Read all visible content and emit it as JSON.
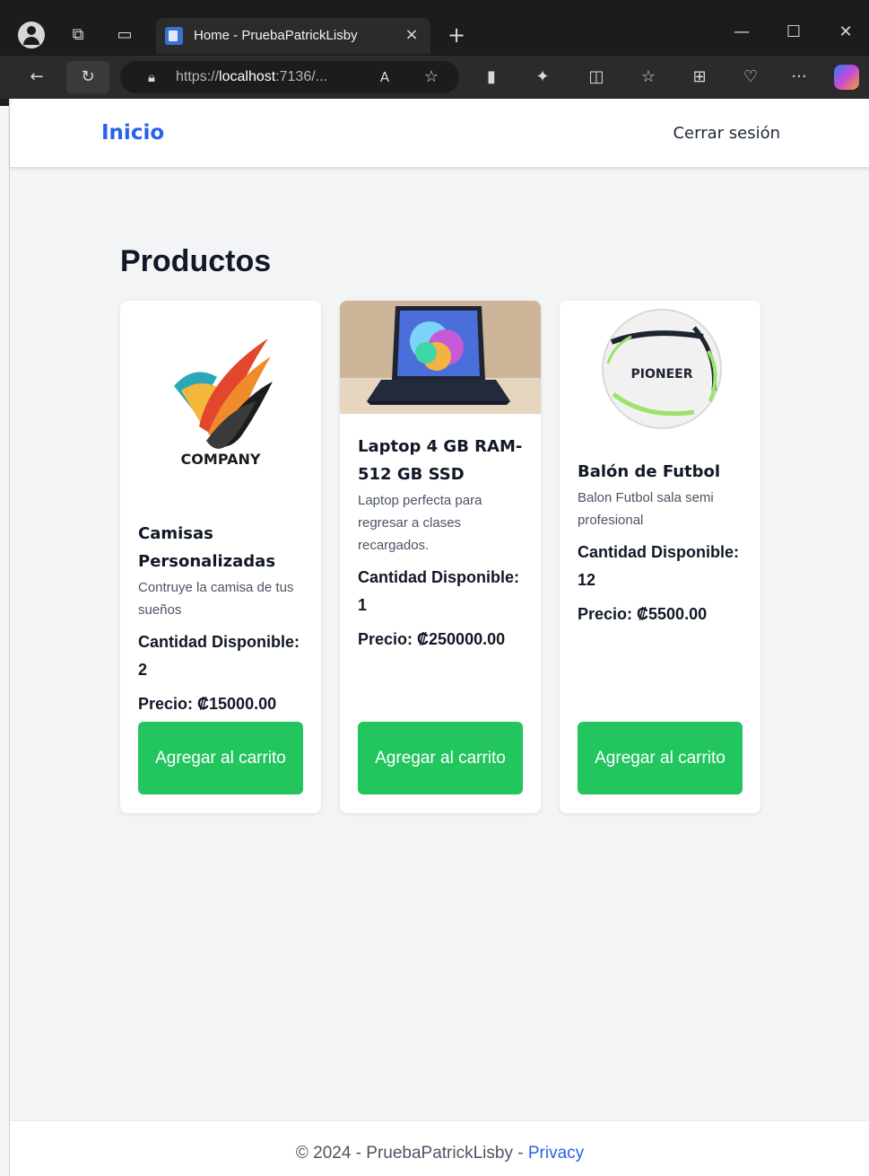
{
  "browser": {
    "tab_title": "Home - PruebaPatrickLisby",
    "url_prefix": "https://",
    "url_host": "localhost",
    "url_rest": ":7136/...",
    "new_tab_symbol": "+",
    "close_tab_symbol": "×",
    "more_symbol": "···"
  },
  "navbar": {
    "brand": "Inicio",
    "logout": "Cerrar sesión"
  },
  "main": {
    "title": "Productos"
  },
  "products": [
    {
      "name": "Camisas Personalizadas",
      "image_label": "COMPANY",
      "description": "Contruye la camisa de tus sueños",
      "quantity": "Cantidad Disponible: 2",
      "price": "Precio: ₡15000.00",
      "button": "Agregar al carrito"
    },
    {
      "name": "Laptop 4 GB RAM-512 GB SSD",
      "description": "Laptop perfecta para regresar a clases recargados.",
      "quantity": "Cantidad Disponible: 1",
      "price": "Precio: ₡250000.00",
      "button": "Agregar al carrito"
    },
    {
      "name": "Balón de Futbol",
      "image_label": "PIONEER",
      "description": "Balon Futbol sala semi profesional",
      "quantity": "Cantidad Disponible: 12",
      "price": "Precio: ₡5500.00",
      "button": "Agregar al carrito"
    }
  ],
  "footer": {
    "text": "© 2024 - PruebaPatrickLisby - ",
    "link": "Privacy"
  },
  "colors": {
    "brand": "#2563eb",
    "button": "#22c55e",
    "page_bg": "#f3f4f6"
  }
}
